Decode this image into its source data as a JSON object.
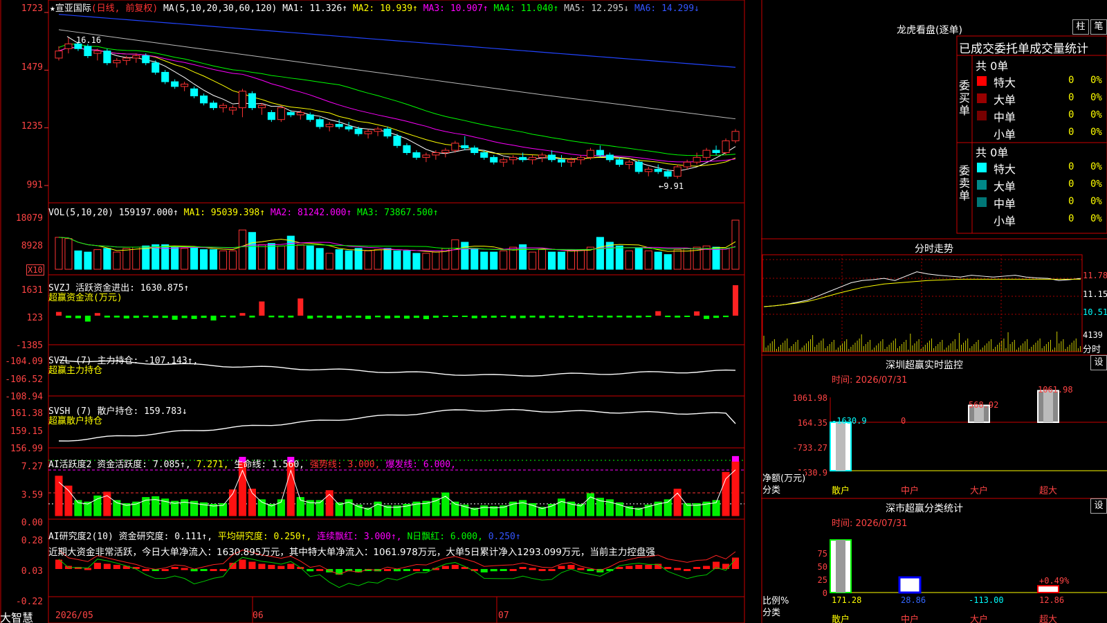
{
  "app": {
    "logo": "大智慧"
  },
  "main": {
    "header": {
      "star": "★",
      "name": "宣亚国际",
      "period": "(日线, 前复权)",
      "ma_def": "MA(5,10,20,30,60,120)",
      "ma1": "MA1: 11.326↑",
      "ma2": "MA2: 10.939↑",
      "ma3": "MA3: 10.907↑",
      "ma4": "MA4: 11.040↑",
      "ma5": "MA5: 12.295↓",
      "ma6": "MA6: 14.299↓"
    },
    "y_labels": [
      "1723",
      "1479",
      "1235",
      "991"
    ],
    "high_note": "16.16",
    "low_note": "←9.91"
  },
  "vol": {
    "title": "VOL(5,10,20)",
    "value": "159197.000↑",
    "ma1": "MA1: 95039.398↑",
    "ma2": "MA2: 81242.000↑",
    "ma3": "MA3: 73867.500↑",
    "y_labels": [
      "18079",
      "8928"
    ],
    "unit": "X10"
  },
  "svzj": {
    "title": "SVZJ  活跃资金进出: 1630.875↑",
    "sub": "超赢资金流(万元)",
    "y_labels": [
      "1631",
      "123",
      "-1385"
    ]
  },
  "svzl": {
    "title": "SVZL (7) 主力持仓: -107.143↑,",
    "sub": "超赢主力持仓",
    "y_labels": [
      "-104.09",
      "-106.52",
      "-108.94"
    ]
  },
  "svsh": {
    "title": "SVSH (7) 散户持仓: 159.783↓",
    "sub": "超赢散户持仓",
    "y_labels": [
      "161.38",
      "159.15",
      "156.99"
    ]
  },
  "ai1": {
    "t1": "AI活跃度2 资金活跃度: 7.085↑,",
    "t2": "7.271,",
    "t3": "生命线: 1.560,",
    "t4": "强势线: 3.000,",
    "t5": "爆发线: 6.000,",
    "y_labels": [
      "7.27",
      "3.59",
      "0.00"
    ]
  },
  "ai2": {
    "t1": "AI研究度2(10) 资金研究度: 0.111↑,",
    "t2": "平均研究度: 0.250↑,",
    "t3": "连续飘红: 3.000↑,",
    "t4": "N日飘红: 6.000,",
    "t5": "0.250↑",
    "comment": "近期大资金非常活跃，今日大单净流入：1630.895万元，其中特大单净流入：1061.978万元，大单5日累计净入1293.099万元，当前主力控盘强",
    "y_labels": [
      "0.28",
      "0.03",
      "-0.22"
    ]
  },
  "x_axis": [
    "2026/05",
    "06",
    "07"
  ],
  "dragon": {
    "title": "龙虎看盘(逐单)",
    "btn1": "柱",
    "btn2": "笔",
    "header": "已成交委托单成交量统计",
    "buy_label": "委买单",
    "sell_label": "委卖单",
    "buy_total": "共 0单",
    "sell_total": "共 0单",
    "buy_rows": [
      {
        "label": "特大",
        "num": "0",
        "pct": "0%",
        "color": "#ff0000"
      },
      {
        "label": "大单",
        "num": "0",
        "pct": "0%",
        "color": "#990000"
      },
      {
        "label": "中单",
        "num": "0",
        "pct": "0%",
        "color": "#770000"
      },
      {
        "label": "小单",
        "num": "0",
        "pct": "0%",
        "color": "#000000"
      }
    ],
    "sell_rows": [
      {
        "label": "特大",
        "num": "0",
        "pct": "0%",
        "color": "#00ffff"
      },
      {
        "label": "大单",
        "num": "0",
        "pct": "0%",
        "color": "#008888"
      },
      {
        "label": "中单",
        "num": "0",
        "pct": "0%",
        "color": "#007777"
      },
      {
        "label": "小单",
        "num": "0",
        "pct": "0%",
        "color": "#000000"
      }
    ]
  },
  "intraday": {
    "title": "分时走势",
    "y_labels": [
      "11.78",
      "11.15",
      "10.51"
    ],
    "vol_label": "4139",
    "unit": "分时"
  },
  "monitor": {
    "title": "深圳超赢实时监控",
    "btn": "设",
    "time": "时间: 2026/07/31",
    "y_labels": [
      "1061.98",
      "164.35",
      "-733.27",
      "-1630.9"
    ],
    "bar_labels": [
      "-1630.9",
      "0",
      "568.92",
      "1061.98"
    ],
    "values": [
      -1630.9,
      0,
      568.92,
      1061.98
    ],
    "net_label": "净额(万元)",
    "cat_label": "分类",
    "cats": [
      "散户",
      "中户",
      "大户",
      "超大"
    ]
  },
  "stats": {
    "title": "深市超赢分类统计",
    "btn": "设",
    "time": "时间: 2026/07/31",
    "y_labels": [
      "75",
      "50",
      "25",
      "0"
    ],
    "pct_label": "+0.49%",
    "ratio_label": "比例%",
    "cat_label": "分类",
    "values": [
      "171.28",
      "28.86",
      "-113.00",
      "12.86"
    ],
    "cats": [
      "散户",
      "中户",
      "大户",
      "超大"
    ]
  },
  "chart_data": {
    "type": "candlestick",
    "candles": [
      [
        15.3,
        15.8,
        15.2,
        15.6
      ],
      [
        15.7,
        16.16,
        15.5,
        15.9
      ],
      [
        15.9,
        16.0,
        15.6,
        15.7
      ],
      [
        15.8,
        15.9,
        15.3,
        15.4
      ],
      [
        15.5,
        15.7,
        15.2,
        15.6
      ],
      [
        15.6,
        15.7,
        15.0,
        15.1
      ],
      [
        15.1,
        15.3,
        14.9,
        15.2
      ],
      [
        15.2,
        15.4,
        15.0,
        15.3
      ],
      [
        15.3,
        15.5,
        15.1,
        15.4
      ],
      [
        15.4,
        15.5,
        15.0,
        15.1
      ],
      [
        15.1,
        15.2,
        14.6,
        14.7
      ],
      [
        14.7,
        14.8,
        14.2,
        14.3
      ],
      [
        14.3,
        14.4,
        14.0,
        14.1
      ],
      [
        14.1,
        14.3,
        13.9,
        14.2
      ],
      [
        14.0,
        14.1,
        13.6,
        13.7
      ],
      [
        13.7,
        13.8,
        13.3,
        13.4
      ],
      [
        13.4,
        13.5,
        13.1,
        13.2
      ],
      [
        13.2,
        13.4,
        13.0,
        13.3
      ],
      [
        13.1,
        13.3,
        12.9,
        13.2
      ],
      [
        13.2,
        14.0,
        12.8,
        13.9
      ],
      [
        13.8,
        13.9,
        13.1,
        13.2
      ],
      [
        13.2,
        13.4,
        12.9,
        13.3
      ],
      [
        13.0,
        13.1,
        12.6,
        12.7
      ],
      [
        12.7,
        13.3,
        12.6,
        13.2
      ],
      [
        13.0,
        13.1,
        12.8,
        12.9
      ],
      [
        12.9,
        13.1,
        12.7,
        13.0
      ],
      [
        12.9,
        13.0,
        12.6,
        12.7
      ],
      [
        12.7,
        12.8,
        12.3,
        12.4
      ],
      [
        12.4,
        12.6,
        12.2,
        12.5
      ],
      [
        12.5,
        12.7,
        12.3,
        12.4
      ],
      [
        12.4,
        12.6,
        12.2,
        12.3
      ],
      [
        12.3,
        12.4,
        12.0,
        12.1
      ],
      [
        12.1,
        12.3,
        11.9,
        12.2
      ],
      [
        12.2,
        12.4,
        12.0,
        12.3
      ],
      [
        12.3,
        12.4,
        11.9,
        12.0
      ],
      [
        12.0,
        12.1,
        11.5,
        11.6
      ],
      [
        11.6,
        11.7,
        11.2,
        11.3
      ],
      [
        11.3,
        11.4,
        11.0,
        11.1
      ],
      [
        11.1,
        11.3,
        10.9,
        11.2
      ],
      [
        11.2,
        11.4,
        11.0,
        11.3
      ],
      [
        11.3,
        11.5,
        11.1,
        11.4
      ],
      [
        11.4,
        11.8,
        11.3,
        11.7
      ],
      [
        11.6,
        12.0,
        11.4,
        11.5
      ],
      [
        11.5,
        11.6,
        11.2,
        11.3
      ],
      [
        11.3,
        11.4,
        11.0,
        11.1
      ],
      [
        11.1,
        11.2,
        10.8,
        10.9
      ],
      [
        10.9,
        11.1,
        10.7,
        11.0
      ],
      [
        11.0,
        11.2,
        10.8,
        11.1
      ],
      [
        11.1,
        11.3,
        10.9,
        11.0
      ],
      [
        11.0,
        11.2,
        10.8,
        11.1
      ],
      [
        11.1,
        11.3,
        10.9,
        11.2
      ],
      [
        11.2,
        11.4,
        10.9,
        11.0
      ],
      [
        11.0,
        11.2,
        10.7,
        10.9
      ],
      [
        10.9,
        11.1,
        10.7,
        11.0
      ],
      [
        11.0,
        11.2,
        10.8,
        11.1
      ],
      [
        11.1,
        11.5,
        11.0,
        11.4
      ],
      [
        11.4,
        11.6,
        11.1,
        11.2
      ],
      [
        11.2,
        11.3,
        10.9,
        11.0
      ],
      [
        11.0,
        11.1,
        10.7,
        10.8
      ],
      [
        10.8,
        11.0,
        10.6,
        10.9
      ],
      [
        10.9,
        11.0,
        10.4,
        10.5
      ],
      [
        10.5,
        10.7,
        10.3,
        10.6
      ],
      [
        10.6,
        10.8,
        10.4,
        10.5
      ],
      [
        10.5,
        10.6,
        10.2,
        10.3
      ],
      [
        10.3,
        10.8,
        10.2,
        10.7
      ],
      [
        10.7,
        11.0,
        10.6,
        10.9
      ],
      [
        10.9,
        11.3,
        10.8,
        11.1
      ],
      [
        11.1,
        11.5,
        11.0,
        11.4
      ],
      [
        11.4,
        11.6,
        11.2,
        11.3
      ],
      [
        11.3,
        11.9,
        11.2,
        11.8
      ],
      [
        11.8,
        12.3,
        11.7,
        12.2
      ]
    ],
    "volume": [
      26,
      25,
      15,
      14,
      16,
      17,
      14,
      17,
      18,
      19,
      20,
      20,
      18,
      17,
      18,
      16,
      16,
      15,
      15,
      32,
      30,
      20,
      21,
      19,
      27,
      20,
      19,
      17,
      13,
      16,
      15,
      17,
      15,
      16,
      17,
      15,
      15,
      13,
      13,
      14,
      17,
      24,
      22,
      17,
      14,
      14,
      15,
      18,
      20,
      14,
      16,
      14,
      14,
      16,
      16,
      18,
      26,
      22,
      19,
      15,
      17,
      15,
      14,
      12,
      16,
      17,
      18,
      19,
      18,
      17,
      40
    ],
    "fund_flow": [
      200,
      -120,
      -140,
      -320,
      140,
      -100,
      -100,
      -150,
      -120,
      -90,
      -120,
      -120,
      -220,
      -130,
      -180,
      -120,
      -260,
      -80,
      -100,
      140,
      -100,
      760,
      -90,
      -100,
      -100,
      920,
      -160,
      -100,
      -120,
      -160,
      -100,
      -110,
      -180,
      -90,
      -150,
      -120,
      -160,
      -120,
      -190,
      -110,
      -70,
      -70,
      -60,
      -140,
      -120,
      -110,
      -80,
      -140,
      -130,
      -100,
      -130,
      -90,
      -120,
      -80,
      -120,
      -80,
      -90,
      -100,
      -90,
      -100,
      -100,
      -80,
      240,
      -80,
      -100,
      -70,
      230,
      -180,
      -120,
      -80,
      1630
    ],
    "ai1": [
      5.2,
      3.9,
      2.0,
      1.8,
      2.6,
      3.1,
      2.0,
      1.6,
      1.8,
      2.4,
      2.5,
      2.2,
      1.9,
      2.1,
      1.9,
      1.7,
      1.5,
      1.6,
      3.4,
      7.0,
      3.5,
      2.1,
      1.5,
      2.1,
      7.0,
      2.4,
      2.0,
      2.0,
      3.3,
      1.7,
      2.1,
      1.4,
      1.0,
      1.8,
      1.3,
      1.3,
      1.5,
      1.8,
      1.9,
      2.3,
      3.0,
      1.8,
      1.4,
      1.0,
      1.3,
      1.2,
      1.3,
      1.8,
      2.0,
      1.6,
      1.1,
      1.5,
      2.2,
      1.8,
      1.5,
      2.9,
      2.3,
      2.1,
      1.7,
      1.2,
      1.0,
      1.4,
      1.8,
      2.1,
      3.5,
      1.6,
      1.6,
      1.8,
      2.0,
      5.7,
      7.1
    ],
    "ai2": [
      0.09,
      0.03,
      0.02,
      0.01,
      0.06,
      0.05,
      0.04,
      0.03,
      0.02,
      0.0,
      -0.01,
      0.0,
      0.02,
      0.01,
      -0.02,
      -0.01,
      0.0,
      0.0,
      0.06,
      0.09,
      0.07,
      0.05,
      0.04,
      0.03,
      0.05,
      0.02,
      -0.02,
      0.0,
      -0.03,
      -0.05,
      -0.02,
      -0.03,
      -0.01,
      -0.02,
      0.0,
      -0.02,
      -0.01,
      0.0,
      -0.01,
      0.01,
      0.03,
      0.04,
      0.02,
      0.0,
      -0.03,
      -0.02,
      -0.01,
      0.0,
      0.02,
      0.01,
      0.0,
      0.0,
      0.03,
      0.04,
      0.01,
      -0.01,
      -0.03,
      -0.01,
      0.02,
      0.03,
      0.04,
      0.04,
      0.05,
      0.02,
      0.01,
      0.0,
      0.02,
      0.03,
      0.07,
      0.05,
      0.11
    ],
    "intraday_price": [
      10.7,
      10.72,
      10.75,
      10.8,
      10.85,
      10.95,
      11.05,
      11.15,
      11.25,
      11.3,
      11.32,
      11.35,
      11.3,
      11.4,
      11.5,
      11.45,
      11.42,
      11.4,
      11.38,
      11.42,
      11.4,
      11.38,
      11.4,
      11.42,
      11.38,
      11.36,
      11.35,
      11.3,
      11.32,
      11.35
    ],
    "intraday_avg": [
      10.7,
      10.72,
      10.75,
      10.78,
      10.82,
      10.88,
      10.95,
      11.02,
      11.08,
      11.14,
      11.18,
      11.22,
      11.24,
      11.26,
      11.28,
      11.3,
      11.31,
      11.32,
      11.33,
      11.33,
      11.33,
      11.33,
      11.33,
      11.33,
      11.33,
      11.33,
      11.33,
      11.33,
      11.33,
      11.33
    ],
    "mon_pct": [
      171.28,
      28.86,
      12.86
    ]
  }
}
